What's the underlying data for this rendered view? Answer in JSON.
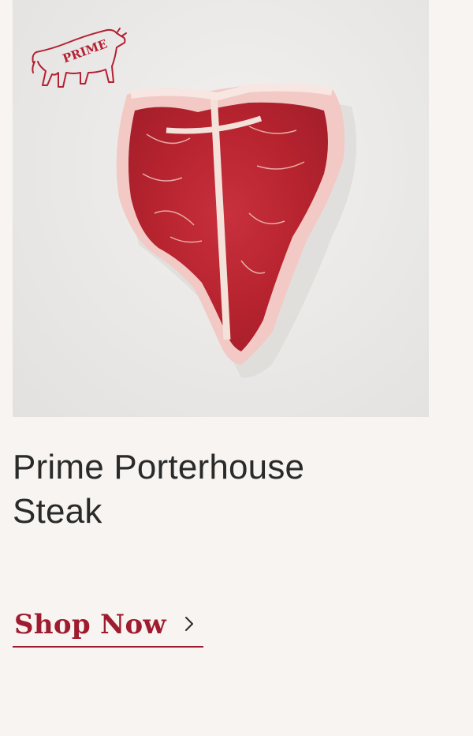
{
  "product": {
    "title": "Prime Porterhouse\nSteak",
    "badge_text": "PRIME",
    "image_alt": "Prime Porterhouse Steak on a light marble surface",
    "cta_label": "Shop Now",
    "cta_icon": "chevron-right-icon"
  },
  "colors": {
    "background": "#f7f4f1",
    "accent": "#9e1c2e",
    "title_text": "#2a2a2a"
  }
}
